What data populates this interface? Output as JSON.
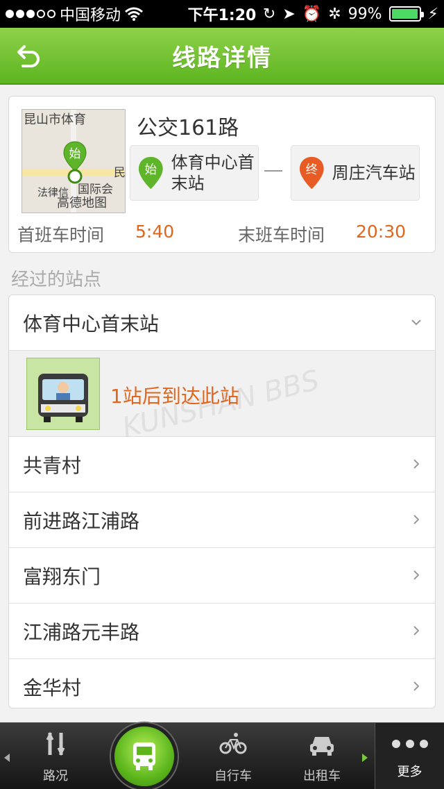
{
  "status_bar": {
    "carrier": "中国移动",
    "time": "下午1:20",
    "battery": "99%",
    "battery_level": 0.99
  },
  "nav": {
    "title": "线路详情",
    "back_icon": "back-arrow-icon"
  },
  "route": {
    "name": "公交161路",
    "map_labels": [
      "昆山市体育",
      "法律信",
      "国际会",
      "民",
      "高德地图"
    ],
    "start_badge": "始",
    "end_badge": "终",
    "start_stop": "体育中心首末站",
    "end_stop": "周庄汽车站",
    "first_bus_label": "首班车时间",
    "first_bus_time": "5:40",
    "last_bus_label": "末班车时间",
    "last_bus_time": "20:30",
    "colors": {
      "start": "#5fb52a",
      "end": "#e65c24",
      "time": "#e0661e"
    }
  },
  "stations_section": {
    "title": "经过的站点",
    "expanded_station": "体育中心首末站",
    "arrival_text": "1站后到达此站",
    "watermark": "KUNSHAN BBS",
    "stations": [
      "共青村",
      "前进路江浦路",
      "富翔东门",
      "江浦路元丰路",
      "金华村"
    ]
  },
  "tab_bar": {
    "items": [
      {
        "label": "路况",
        "icon": "traffic-icon"
      },
      {
        "label": "",
        "icon": "bus-icon"
      },
      {
        "label": "自行车",
        "icon": "bicycle-icon"
      },
      {
        "label": "出租车",
        "icon": "taxi-icon"
      },
      {
        "label": "更多",
        "icon": "more-icon"
      }
    ]
  }
}
